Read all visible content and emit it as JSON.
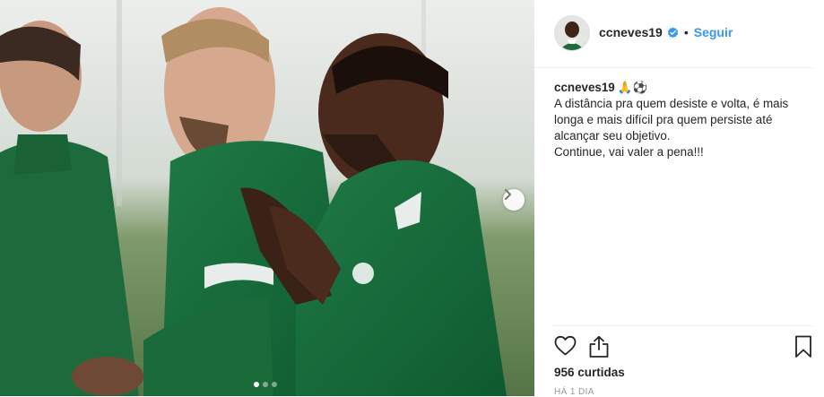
{
  "post": {
    "username": "ccneves19",
    "follow_label": "Seguir",
    "separator": "•",
    "caption_emojis": "🙏⚽",
    "caption_lines": [
      "A distância pra quem desiste e volta, é mais",
      "longa e mais difícil pra quem persiste até",
      "alcançar seu objetivo.",
      "Continue, vai valer a pena!!!"
    ],
    "likes": "956 curtidas",
    "date": "HÁ 1 DIA"
  },
  "carousel": {
    "total_slides": 3,
    "active_slide": 1
  },
  "icons": {
    "verified": "verified-badge-icon",
    "next": "chevron-right-icon",
    "like": "heart-icon",
    "share": "share-icon",
    "save": "bookmark-icon"
  },
  "colors": {
    "accent": "#3897f0",
    "text": "#262626",
    "muted": "#999999",
    "border": "#efefef"
  }
}
